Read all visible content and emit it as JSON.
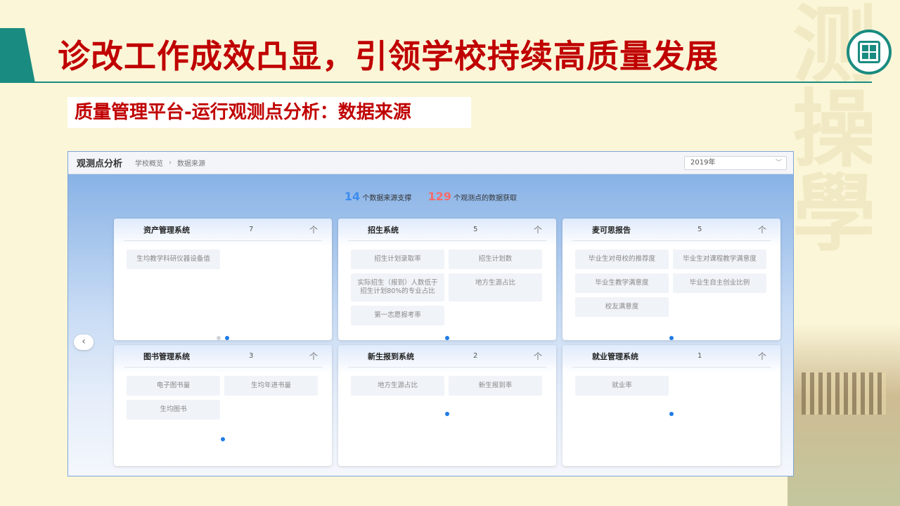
{
  "page": {
    "title": "诊改工作成效凸显，引领学校持续高质量发展",
    "subtitle": "质量管理平台-运行观测点分析：数据来源",
    "background_text": "测操學"
  },
  "app": {
    "panel_title": "观测点分析",
    "breadcrumb": [
      "学校概览",
      "数据来源"
    ],
    "breadcrumb_sep": "›",
    "year_select": "2019年",
    "summary": {
      "sources_count": "14",
      "sources_label": "个数据来源支撑",
      "points_count": "129",
      "points_label": "个观测点的数据获取"
    },
    "prev_symbol": "‹",
    "up_symbol": "个",
    "cards": [
      {
        "name": "资产管理系统",
        "count": "7",
        "items": [
          "生均教学科研仪器设备值"
        ],
        "dots": 2,
        "active_dot": 1
      },
      {
        "name": "招生系统",
        "count": "5",
        "items": [
          "招生计划录取率",
          "招生计划数",
          "实际招生（报到）人数低于招生计划80%的专业占比",
          "地方生源占比",
          "第一志愿报考率"
        ],
        "dots": 1,
        "active_dot": 0
      },
      {
        "name": "麦可思报告",
        "count": "5",
        "items": [
          "毕业生对母校的推荐度",
          "毕业生对课程教学满意度",
          "毕业生教学满意度",
          "毕业生自主创业比例",
          "校友满意度"
        ],
        "dots": 1,
        "active_dot": 0
      },
      {
        "name": "图书管理系统",
        "count": "3",
        "items": [
          "电子图书量",
          "生均年进书量",
          "生均图书"
        ],
        "dots": 1,
        "active_dot": 0
      },
      {
        "name": "新生报到系统",
        "count": "2",
        "items": [
          "地方生源占比",
          "新生报到率"
        ],
        "dots": 1,
        "active_dot": 0
      },
      {
        "name": "就业管理系统",
        "count": "1",
        "items": [
          "就业率"
        ],
        "dots": 1,
        "active_dot": 0
      }
    ]
  },
  "colors": {
    "title_red": "#c00000",
    "accent_teal": "#1a8b80",
    "blue_count": "#3d8cf0",
    "red_count": "#f56c6c",
    "active_dot": "#1e7ce6"
  }
}
